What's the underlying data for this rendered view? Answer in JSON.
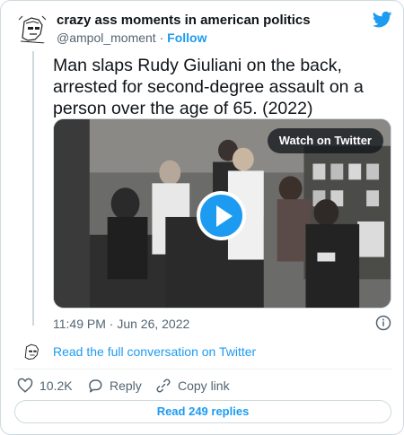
{
  "author": {
    "display_name": "crazy ass moments in american politics",
    "handle": "@ampol_moment",
    "separator": "·",
    "follow_label": "Follow"
  },
  "tweet": {
    "text": "Man slaps Rudy Giuliani on the back, arrested for second-degree assault on a person over the age of 65. (2022)"
  },
  "media": {
    "watch_label": "Watch on Twitter"
  },
  "meta": {
    "timestamp": "11:49 PM · Jun 26, 2022"
  },
  "conversation": {
    "label": "Read the full conversation on Twitter"
  },
  "actions": {
    "likes": "10.2K",
    "reply_label": "Reply",
    "copy_label": "Copy link"
  },
  "replies": {
    "label": "Read 249 replies"
  },
  "colors": {
    "accent": "#1d9bf0",
    "text": "#0f1419",
    "secondary": "#536471",
    "border": "#cfd9de"
  },
  "icons": [
    "avatar-image",
    "twitter-bird-icon",
    "play-icon",
    "info-icon",
    "heart-icon",
    "reply-bubble-icon",
    "link-icon"
  ]
}
